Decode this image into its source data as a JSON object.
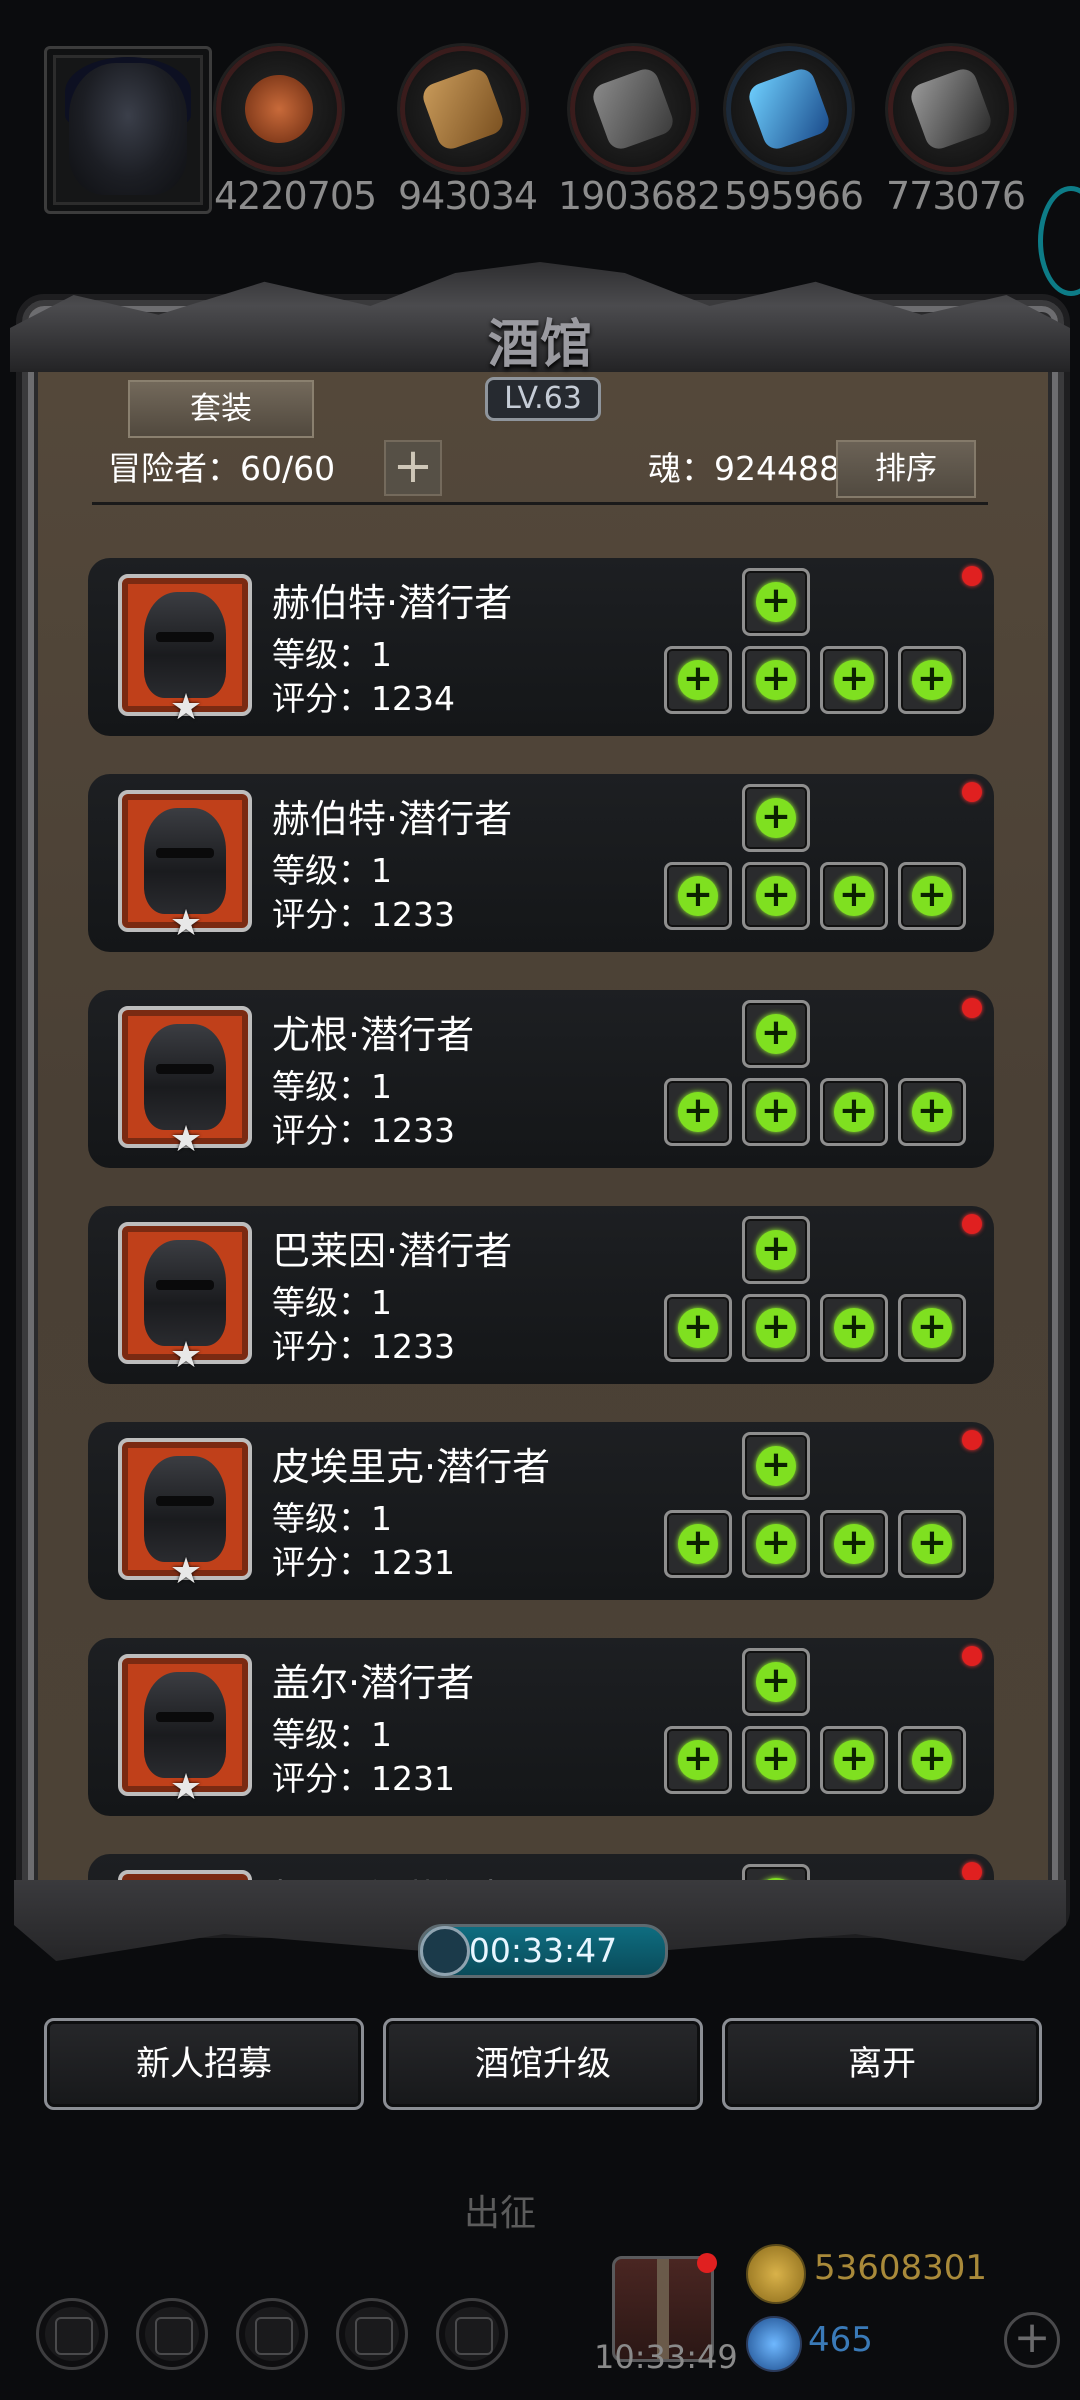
{
  "resources": [
    {
      "name": "ore-icon",
      "value": "4220705"
    },
    {
      "name": "wood-icon",
      "value": "943034"
    },
    {
      "name": "iron-icon",
      "value": "1903682"
    },
    {
      "name": "crystal-icon",
      "value": "595966"
    },
    {
      "name": "steel-icon",
      "value": "773076"
    }
  ],
  "tavern": {
    "title": "酒馆",
    "level": "LV.63",
    "suit_button": "套装",
    "adventurers_label": "冒险者：60/60",
    "plus_symbol": "+",
    "soul_label": "魂：924488",
    "sort_button": "排序",
    "heroes": [
      {
        "name": "赫伯特·潜行者",
        "level": "等级：1",
        "score": "评分：1234"
      },
      {
        "name": "赫伯特·潜行者",
        "level": "等级：1",
        "score": "评分：1233"
      },
      {
        "name": "尤根·潜行者",
        "level": "等级：1",
        "score": "评分：1233"
      },
      {
        "name": "巴莱因·潜行者",
        "level": "等级：1",
        "score": "评分：1233"
      },
      {
        "name": "皮埃里克·潜行者",
        "level": "等级：1",
        "score": "评分：1231"
      },
      {
        "name": "盖尔·潜行者",
        "level": "等级：1",
        "score": "评分：1231"
      },
      {
        "name": "托马兹·潜行者",
        "level": "",
        "score": ""
      }
    ],
    "timer": "00:33:47"
  },
  "actions": {
    "recruit": "新人招募",
    "upgrade": "酒馆升级",
    "leave": "离开"
  },
  "bottom": {
    "expedition": "出征",
    "clock": "10:33:49",
    "gold": "53608301",
    "gems": "465",
    "plus_symbol": "+"
  },
  "colors": {
    "panel": "#4c4236",
    "row": "#17181a",
    "slot_plus": "#7fe020",
    "notify": "#e02020",
    "timer": "#0e6d80"
  }
}
